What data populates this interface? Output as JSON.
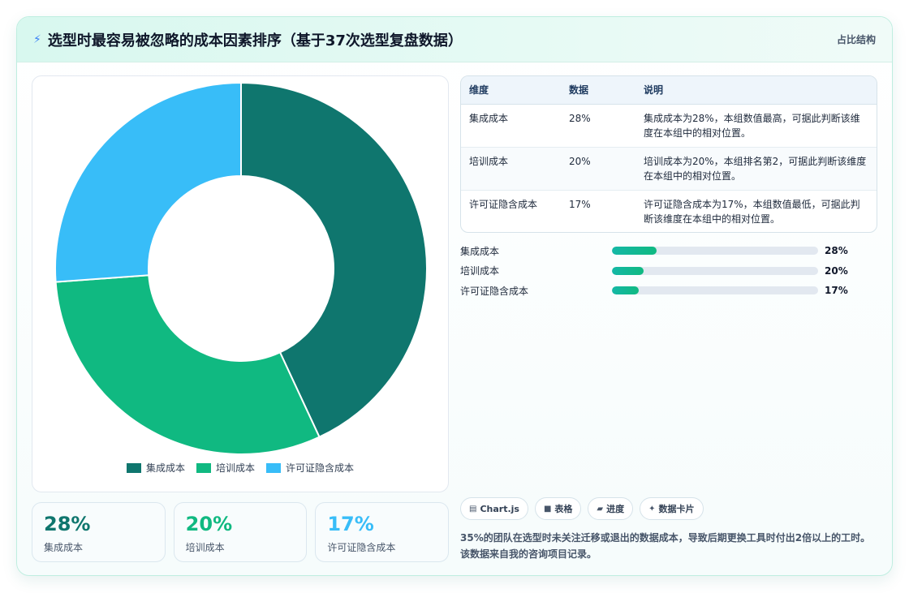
{
  "header": {
    "icon": "bolt-icon",
    "title": "选型时最容易被忽略的成本因素排序（基于37次选型复盘数据）",
    "tag": "占比结构"
  },
  "chart_data": {
    "type": "pie",
    "categories": [
      "集成成本",
      "培训成本",
      "许可证隐含成本"
    ],
    "values": [
      28,
      20,
      17
    ],
    "colors": [
      "#0f766e",
      "#10b981",
      "#38bdf8"
    ],
    "legend": "bottom"
  },
  "stats": [
    {
      "value": "28%",
      "label": "集成成本",
      "color": "#0f766e"
    },
    {
      "value": "20%",
      "label": "培训成本",
      "color": "#10b981"
    },
    {
      "value": "17%",
      "label": "许可证隐含成本",
      "color": "#38bdf8"
    }
  ],
  "table": {
    "headers": [
      "维度",
      "数据",
      "说明"
    ],
    "rows": [
      [
        "集成成本",
        "28%",
        "集成成本为28%，本组数值最高，可据此判断该维度在本组中的相对位置。"
      ],
      [
        "培训成本",
        "20%",
        "培训成本为20%，本组排名第2，可据此判断该维度在本组中的相对位置。"
      ],
      [
        "许可证隐含成本",
        "17%",
        "许可证隐含成本为17%，本组数值最低，可据此判断该维度在本组中的相对位置。"
      ]
    ]
  },
  "bars": [
    {
      "label": "集成成本",
      "value": 28,
      "text": "28%"
    },
    {
      "label": "培训成本",
      "value": 20,
      "text": "20%"
    },
    {
      "label": "许可证隐含成本",
      "value": 17,
      "text": "17%"
    }
  ],
  "bar_scale_max": 130,
  "chips": [
    {
      "icon": "chart-icon",
      "glyph": "▤",
      "label": "Chart.js"
    },
    {
      "icon": "table-icon",
      "glyph": "■",
      "label": "表格"
    },
    {
      "icon": "progress-icon",
      "glyph": "▰",
      "label": "进度"
    },
    {
      "icon": "card-icon",
      "glyph": "✦",
      "label": "数据卡片"
    }
  ],
  "note": "35%的团队在选型时未关注迁移或退出的数据成本，导致后期更换工具时付出2倍以上的工时。该数据来自我的咨询项目记录。"
}
